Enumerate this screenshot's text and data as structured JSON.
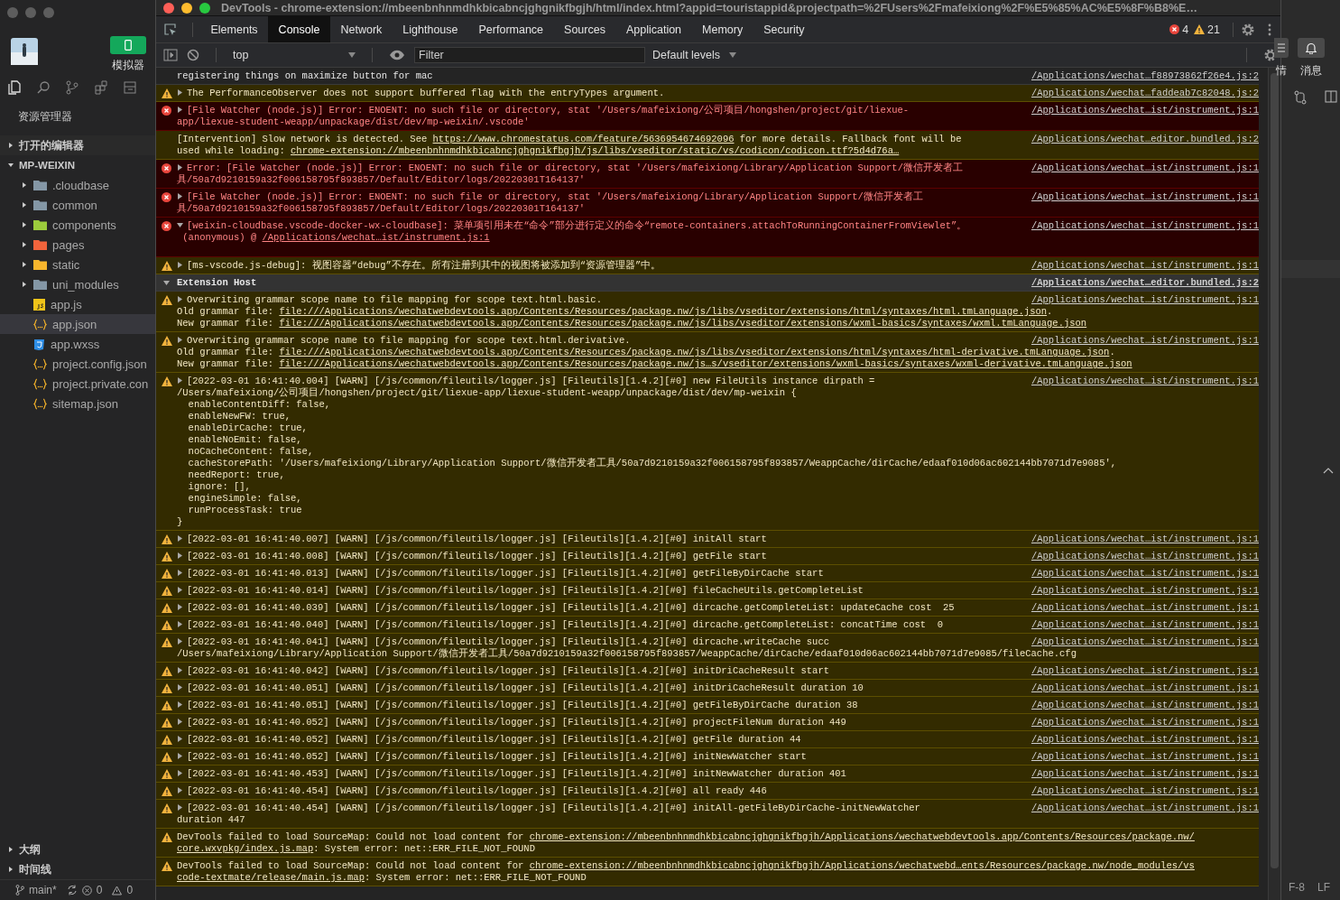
{
  "ide": {
    "simulator_label": "模拟器",
    "explorer_title": "资源管理器",
    "sections": [
      {
        "label": "打开的编辑器",
        "expanded": false
      },
      {
        "label": "MP-WEIXIN",
        "expanded": true,
        "children": [
          {
            "label": ".cloudbase",
            "kind": "folder",
            "color": "#8497a6",
            "expanded": false,
            "selected": false
          },
          {
            "label": "common",
            "kind": "folder",
            "color": "#8497a6",
            "expanded": false,
            "selected": false
          },
          {
            "label": "components",
            "kind": "folder",
            "color": "#9ccc3c",
            "expanded": false,
            "selected": false
          },
          {
            "label": "pages",
            "kind": "folder",
            "color": "#f2643c",
            "expanded": false,
            "selected": false
          },
          {
            "label": "static",
            "kind": "folder",
            "color": "#f8b62d",
            "expanded": false,
            "selected": false
          },
          {
            "label": "uni_modules",
            "kind": "folder",
            "color": "#8497a6",
            "expanded": false,
            "selected": false
          },
          {
            "label": "app.js",
            "kind": "js",
            "selected": false
          },
          {
            "label": "app.json",
            "kind": "json",
            "selected": true
          },
          {
            "label": "app.wxss",
            "kind": "css",
            "selected": false
          },
          {
            "label": "project.config.json",
            "kind": "json",
            "selected": false
          },
          {
            "label": "project.private.con",
            "kind": "json",
            "selected": false
          },
          {
            "label": "sitemap.json",
            "kind": "json",
            "selected": false
          }
        ]
      }
    ],
    "bottom_sections": [
      {
        "label": "大纲",
        "expanded": false
      },
      {
        "label": "时间线",
        "expanded": false
      }
    ],
    "status_bar": {
      "branch": "main*",
      "errors": "0",
      "warnings": "0"
    }
  },
  "devtools": {
    "title": "DevTools - chrome-extension://mbeenbnhnmdhkbicabncjghgnikfbgjh/html/index.html?appid=touristappid&projectpath=%2FUsers%2Fmafeixiong%2F%E5%85%AC%E5%8F%B8%E…",
    "tabs": [
      {
        "label": "Elements",
        "selected": false
      },
      {
        "label": "Console",
        "selected": true
      },
      {
        "label": "Network",
        "selected": false
      },
      {
        "label": "Lighthouse",
        "selected": false
      },
      {
        "label": "Performance",
        "selected": false
      },
      {
        "label": "Sources",
        "selected": false
      },
      {
        "label": "Application",
        "selected": false
      },
      {
        "label": "Memory",
        "selected": false
      },
      {
        "label": "Security",
        "selected": false
      }
    ],
    "error_count": "4",
    "warning_count": "21",
    "context": "top",
    "filter": {
      "placeholder": "Filter"
    },
    "levels": "Default levels",
    "messages": [
      {
        "kind": "log",
        "lines": [
          "registering things on maximize button for mac"
        ],
        "source": "/Applications/wechat…f88973862f26e4.js:2"
      },
      {
        "kind": "warning",
        "expanded": false,
        "lines": [
          "The PerformanceObserver does not support buffered flag with the entryTypes argument."
        ],
        "source": "/Applications/wechat…faddeab7c82048.js:2"
      },
      {
        "kind": "error",
        "expanded": false,
        "lines": [
          "[File Watcher (node.js)] Error: ENOENT: no such file or directory, stat '/Users/mafeixiong/公司项目/hongshen/project/git/liexue-",
          "app/liexue-student-weapp/unpackage/dist/dev/mp-weixin/.vscode'"
        ],
        "source": "/Applications/wechat…ist/instrument.js:1"
      },
      {
        "kind": "intervention",
        "lines": [
          [
            {
              "kind": "text",
              "text": "[Intervention] Slow network is detected. See "
            },
            {
              "kind": "link",
              "text": "https://www.chromestatus.com/feature/5636954674692096"
            },
            {
              "kind": "text",
              "text": " for more details. Fallback font will be"
            }
          ],
          [
            {
              "kind": "text",
              "text": "used while loading: "
            },
            {
              "kind": "link",
              "text": "chrome-extension://mbeenbnhnmdhkbicabncjghgnikfbgjh/js/libs/vseditor/static/vs/codicon/codicon.ttf?5d4d76a…"
            }
          ]
        ],
        "source": "/Applications/wechat…editor.bundled.js:2"
      },
      {
        "kind": "error",
        "expanded": false,
        "lines": [
          "Error: [File Watcher (node.js)] Error: ENOENT: no such file or directory, stat '/Users/mafeixiong/Library/Application Support/微信开发者工",
          "具/50a7d9210159a32f006158795f893857/Default/Editor/logs/20220301T164137'"
        ],
        "source": "/Applications/wechat…ist/instrument.js:1"
      },
      {
        "kind": "error",
        "expanded": false,
        "lines": [
          "[File Watcher (node.js)] Error: ENOENT: no such file or directory, stat '/Users/mafeixiong/Library/Application Support/微信开发者工",
          "具/50a7d9210159a32f006158795f893857/Default/Editor/logs/20220301T164137'"
        ],
        "source": "/Applications/wechat…ist/instrument.js:1"
      },
      {
        "kind": "error",
        "expanded": true,
        "lines": [
          "[weixin-cloudbase.vscode-docker-wx-cloudbase]: 菜单项引用未在“命令”部分进行定义的命令“remote-containers.attachToRunningContainerFromViewlet”。",
          [
            {
              "kind": "text",
              "text": " (anonymous) @ "
            },
            {
              "kind": "link",
              "text": "/Applications/wechat…ist/instrument.js:1"
            }
          ]
        ],
        "source": "/Applications/wechat…ist/instrument.js:1"
      },
      {
        "kind": "warning",
        "expanded": false,
        "lines": [
          "[ms-vscode.js-debug]: 视图容器“debug”不存在。所有注册到其中的视图将被添加到“资源管理器”中。"
        ],
        "source": "/Applications/wechat…ist/instrument.js:1"
      },
      {
        "kind": "group",
        "label": "Extension Host",
        "expanded": true,
        "source": "/Applications/wechat…editor.bundled.js:2",
        "children": [
          {
            "kind": "warning",
            "expanded": false,
            "lines": [
              "Overwriting grammar scope name to file mapping for scope text.html.basic.",
              [
                {
                  "kind": "text",
                  "text": "Old grammar file: "
                },
                {
                  "kind": "link",
                  "text": "file:///Applications/wechatwebdevtools.app/Contents/Resources/package.nw/js/libs/vseditor/extensions/html/syntaxes/html.tmLanguage.json"
                },
                {
                  "kind": "text",
                  "text": "."
                }
              ],
              [
                {
                  "kind": "text",
                  "text": "New grammar file: "
                },
                {
                  "kind": "link",
                  "text": "file:///Applications/wechatwebdevtools.app/Contents/Resources/package.nw/js/libs/vseditor/extensions/wxml-basics/syntaxes/wxml.tmLanguage.json"
                }
              ]
            ],
            "source": "/Applications/wechat…ist/instrument.js:1"
          },
          {
            "kind": "warning",
            "expanded": false,
            "lines": [
              "Overwriting grammar scope name to file mapping for scope text.html.derivative.",
              [
                {
                  "kind": "text",
                  "text": "Old grammar file: "
                },
                {
                  "kind": "link",
                  "text": "file:///Applications/wechatwebdevtools.app/Contents/Resources/package.nw/js/libs/vseditor/extensions/html/syntaxes/html-derivative.tmLanguage.json"
                },
                {
                  "kind": "text",
                  "text": "."
                }
              ],
              [
                {
                  "kind": "text",
                  "text": "New grammar file: "
                },
                {
                  "kind": "link",
                  "text": "file:///Applications/wechatwebdevtools.app/Contents/Resources/package.nw/js…s/vseditor/extensions/wxml-basics/syntaxes/wxml-derivative.tmLanguage.json"
                }
              ]
            ],
            "source": "/Applications/wechat…ist/instrument.js:1"
          },
          {
            "kind": "warning",
            "expanded": false,
            "lines": [
              "[2022-03-01 16:41:40.004] [WARN] [/js/common/fileutils/logger.js] [Fileutils][1.4.2][#0] new FileUtils instance dirpath =",
              "/Users/mafeixiong/公司项目/hongshen/project/git/liexue-app/liexue-student-weapp/unpackage/dist/dev/mp-weixin {",
              "  enableContentDiff: false,",
              "  enableNewFW: true,",
              "  enableDirCache: true,",
              "  enableNoEmit: false,",
              "  noCacheContent: false,",
              "  cacheStorePath: '/Users/mafeixiong/Library/Application Support/微信开发者工具/50a7d9210159a32f006158795f893857/WeappCache/dirCache/edaaf010d06ac602144bb7071d7e9085',",
              "  needReport: true,",
              "  ignore: [],",
              "  engineSimple: false,",
              "  runProcessTask: true",
              "}"
            ],
            "source": "/Applications/wechat…ist/instrument.js:1"
          },
          {
            "kind": "warning",
            "expanded": false,
            "lines": [
              "[2022-03-01 16:41:40.007] [WARN] [/js/common/fileutils/logger.js] [Fileutils][1.4.2][#0] initAll start"
            ],
            "source": "/Applications/wechat…ist/instrument.js:1"
          },
          {
            "kind": "warning",
            "expanded": false,
            "lines": [
              "[2022-03-01 16:41:40.008] [WARN] [/js/common/fileutils/logger.js] [Fileutils][1.4.2][#0] getFile start"
            ],
            "source": "/Applications/wechat…ist/instrument.js:1"
          },
          {
            "kind": "warning",
            "expanded": false,
            "lines": [
              "[2022-03-01 16:41:40.013] [WARN] [/js/common/fileutils/logger.js] [Fileutils][1.4.2][#0] getFileByDirCache start"
            ],
            "source": "/Applications/wechat…ist/instrument.js:1"
          },
          {
            "kind": "warning",
            "expanded": false,
            "lines": [
              "[2022-03-01 16:41:40.014] [WARN] [/js/common/fileutils/logger.js] [Fileutils][1.4.2][#0] fileCacheUtils.getCompleteList"
            ],
            "source": "/Applications/wechat…ist/instrument.js:1"
          },
          {
            "kind": "warning",
            "expanded": false,
            "lines": [
              "[2022-03-01 16:41:40.039] [WARN] [/js/common/fileutils/logger.js] [Fileutils][1.4.2][#0] dircache.getCompleteList: updateCache cost  25"
            ],
            "source": "/Applications/wechat…ist/instrument.js:1"
          },
          {
            "kind": "warning",
            "expanded": false,
            "lines": [
              "[2022-03-01 16:41:40.040] [WARN] [/js/common/fileutils/logger.js] [Fileutils][1.4.2][#0] dircache.getCompleteList: concatTime cost  0"
            ],
            "source": "/Applications/wechat…ist/instrument.js:1"
          },
          {
            "kind": "warning",
            "expanded": false,
            "lines": [
              "[2022-03-01 16:41:40.041] [WARN] [/js/common/fileutils/logger.js] [Fileutils][1.4.2][#0] dircache.writeCache succ",
              "/Users/mafeixiong/Library/Application Support/微信开发者工具/50a7d9210159a32f006158795f893857/WeappCache/dirCache/edaaf010d06ac602144bb7071d7e9085/fileCache.cfg"
            ],
            "source": "/Applications/wechat…ist/instrument.js:1"
          },
          {
            "kind": "warning",
            "expanded": false,
            "lines": [
              "[2022-03-01 16:41:40.042] [WARN] [/js/common/fileutils/logger.js] [Fileutils][1.4.2][#0] initDriCacheResult start"
            ],
            "source": "/Applications/wechat…ist/instrument.js:1"
          },
          {
            "kind": "warning",
            "expanded": false,
            "lines": [
              "[2022-03-01 16:41:40.051] [WARN] [/js/common/fileutils/logger.js] [Fileutils][1.4.2][#0] initDriCacheResult duration 10"
            ],
            "source": "/Applications/wechat…ist/instrument.js:1"
          },
          {
            "kind": "warning",
            "expanded": false,
            "lines": [
              "[2022-03-01 16:41:40.051] [WARN] [/js/common/fileutils/logger.js] [Fileutils][1.4.2][#0] getFileByDirCache duration 38"
            ],
            "source": "/Applications/wechat…ist/instrument.js:1"
          },
          {
            "kind": "warning",
            "expanded": false,
            "lines": [
              "[2022-03-01 16:41:40.052] [WARN] [/js/common/fileutils/logger.js] [Fileutils][1.4.2][#0] projectFileNum duration 449"
            ],
            "source": "/Applications/wechat…ist/instrument.js:1"
          },
          {
            "kind": "warning",
            "expanded": false,
            "lines": [
              "[2022-03-01 16:41:40.052] [WARN] [/js/common/fileutils/logger.js] [Fileutils][1.4.2][#0] getFile duration 44"
            ],
            "source": "/Applications/wechat…ist/instrument.js:1"
          },
          {
            "kind": "warning",
            "expanded": false,
            "lines": [
              "[2022-03-01 16:41:40.052] [WARN] [/js/common/fileutils/logger.js] [Fileutils][1.4.2][#0] initNewWatcher start"
            ],
            "source": "/Applications/wechat…ist/instrument.js:1"
          },
          {
            "kind": "warning",
            "expanded": false,
            "lines": [
              "[2022-03-01 16:41:40.453] [WARN] [/js/common/fileutils/logger.js] [Fileutils][1.4.2][#0] initNewWatcher duration 401"
            ],
            "source": "/Applications/wechat…ist/instrument.js:1"
          },
          {
            "kind": "warning",
            "expanded": false,
            "lines": [
              "[2022-03-01 16:41:40.454] [WARN] [/js/common/fileutils/logger.js] [Fileutils][1.4.2][#0] all ready 446"
            ],
            "source": "/Applications/wechat…ist/instrument.js:1"
          },
          {
            "kind": "warning",
            "expanded": false,
            "lines": [
              "[2022-03-01 16:41:40.454] [WARN] [/js/common/fileutils/logger.js] [Fileutils][1.4.2][#0] initAll-getFileByDirCache-initNewWatcher",
              "duration 447"
            ],
            "source": "/Applications/wechat…ist/instrument.js:1"
          },
          {
            "kind": "warning",
            "lines": [
              [
                {
                  "kind": "text",
                  "text": "DevTools failed to load SourceMap: Could not load content for "
                },
                {
                  "kind": "link",
                  "text": "chrome-extension://mbeenbnhnmdhkbicabncjghgnikfbgjh/Applications/wechatwebdevtools.app/Contents/Resources/package.nw/"
                }
              ],
              [
                {
                  "kind": "link",
                  "text": "core.wxvpkg/index.js.map"
                },
                {
                  "kind": "text",
                  "text": ": System error: net::ERR_FILE_NOT_FOUND"
                }
              ]
            ]
          },
          {
            "kind": "warning",
            "lines": [
              [
                {
                  "kind": "text",
                  "text": "DevTools failed to load SourceMap: Could not load content for "
                },
                {
                  "kind": "link",
                  "text": "chrome-extension://mbeenbnhnmdhkbicabncjghgnikfbgjh/Applications/wechatwebd…ents/Resources/package.nw/node_modules/vs"
                }
              ],
              [
                {
                  "kind": "link",
                  "text": "code-textmate/release/main.js.map"
                },
                {
                  "kind": "text",
                  "text": ": System error: net::ERR_FILE_NOT_FOUND"
                }
              ]
            ]
          }
        ]
      }
    ]
  },
  "side_panel": {
    "details_label": "情",
    "messages_label": "消息",
    "encoding": "F-8",
    "line_ending": "LF"
  }
}
